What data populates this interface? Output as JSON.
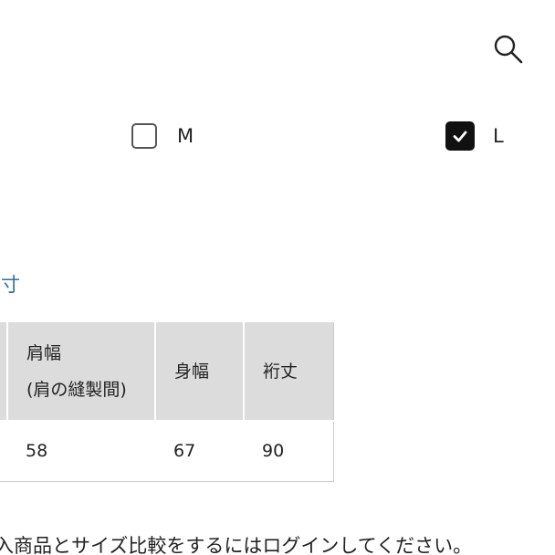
{
  "header": {
    "search_icon": "search-icon"
  },
  "size_selector": {
    "options": [
      {
        "label": "M",
        "checked": false
      },
      {
        "label": "L",
        "checked": true
      }
    ]
  },
  "size_link": "ズ寸",
  "size_table": {
    "headers": [
      {
        "line1": "",
        "line2": ""
      },
      {
        "line1": "肩幅",
        "line2": "(肩の縫製間)"
      },
      {
        "line1": "身幅",
        "line2": ""
      },
      {
        "line1": "裄丈",
        "line2": ""
      }
    ],
    "row": [
      "",
      "58",
      "67",
      "90"
    ]
  },
  "note": "入商品とサイズ比較をするにはログインしてください。"
}
